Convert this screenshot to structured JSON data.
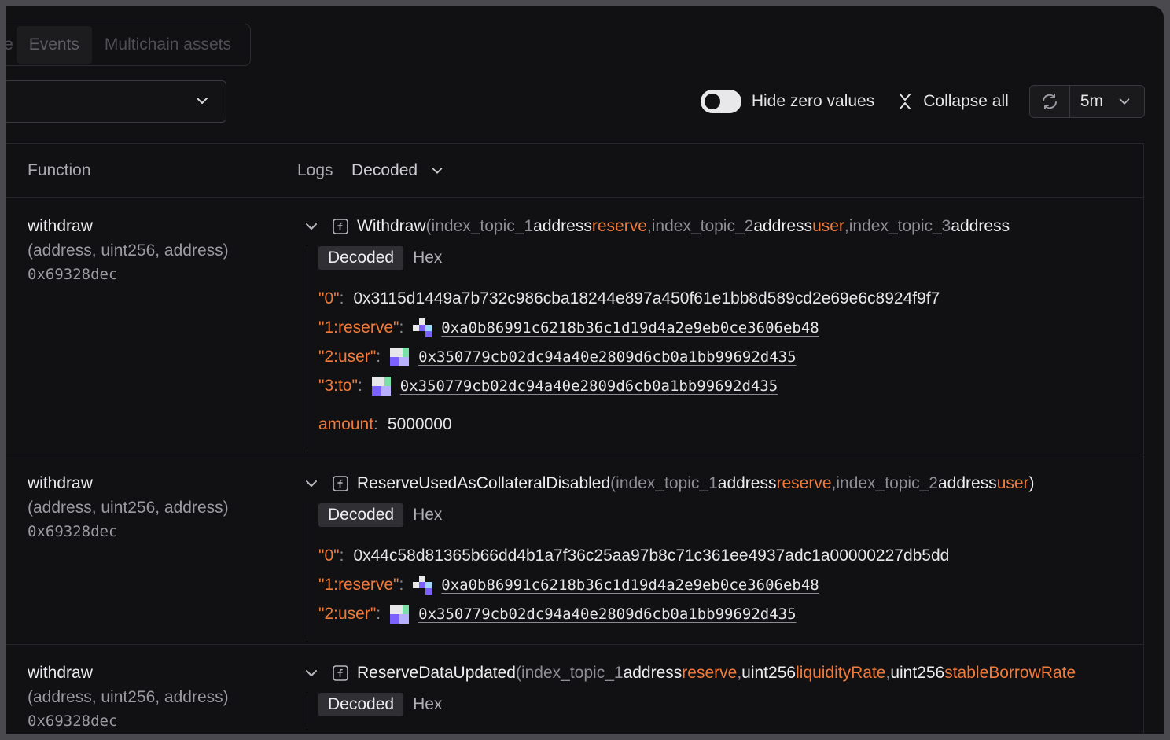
{
  "tabs": [
    "e",
    "Events",
    "Multichain assets"
  ],
  "toolbar": {
    "hide_zero_label": "Hide zero values",
    "collapse_label": "Collapse all",
    "interval": "5m"
  },
  "table": {
    "col_function": "Function",
    "col_logs": "Logs",
    "logs_mode": "Decoded"
  },
  "subtabs": {
    "decoded": "Decoded",
    "hex": "Hex"
  },
  "rows": [
    {
      "fn_name": "withdraw",
      "fn_sig": "(address, uint256, address)",
      "fn_selector": "0x69328dec",
      "event": {
        "name": "Withdraw",
        "p_open": " (",
        "t1": "index_topic_1 ",
        "t1_type": "address ",
        "t1_name": "reserve",
        "sep1": ", ",
        "t2": "index_topic_2 ",
        "t2_type": "address ",
        "t2_name": "user",
        "sep2": ", ",
        "t3": "index_topic_3 ",
        "t3_type": "address"
      },
      "fields": [
        {
          "key": "\"0\"",
          "value": "0x3115d1449a7b732c986cba18244e897a450f61e1bb8d589cd2e69e6c8924f9f7",
          "is_addr": false
        },
        {
          "key": "\"1:reserve\"",
          "value": "0xa0b86991c6218b36c1d19d4a2e9eb0ce3606eb48",
          "is_addr": true
        },
        {
          "key": "\"2:user\"",
          "value": "0x350779cb02dc94a40e2809d6cb0a1bb99692d435",
          "is_addr": true
        },
        {
          "key": "\"3:to\"",
          "value": "0x350779cb02dc94a40e2809d6cb0a1bb99692d435",
          "is_addr": true
        }
      ],
      "amount_key": "amount",
      "amount_value": "5000000"
    },
    {
      "fn_name": "withdraw",
      "fn_sig": "(address, uint256, address)",
      "fn_selector": "0x69328dec",
      "event": {
        "name": "ReserveUsedAsCollateralDisabled",
        "p_open": " (",
        "t1": "index_topic_1 ",
        "t1_type": "address ",
        "t1_name": "reserve",
        "sep1": ", ",
        "t2": "index_topic_2 ",
        "t2_type": "address ",
        "t2_name": "user",
        "p_close": ")"
      },
      "fields": [
        {
          "key": "\"0\"",
          "value": "0x44c58d81365b66dd4b1a7f36c25aa97b8c71c361ee4937adc1a00000227db5dd",
          "is_addr": false
        },
        {
          "key": "\"1:reserve\"",
          "value": "0xa0b86991c6218b36c1d19d4a2e9eb0ce3606eb48",
          "is_addr": true
        },
        {
          "key": "\"2:user\"",
          "value": "0x350779cb02dc94a40e2809d6cb0a1bb99692d435",
          "is_addr": true
        }
      ]
    },
    {
      "fn_name": "withdraw",
      "fn_sig": "(address, uint256, address)",
      "fn_selector": "0x69328dec",
      "event": {
        "name": "ReserveDataUpdated",
        "p_open": " (",
        "t1": "index_topic_1 ",
        "t1_type": "address ",
        "t1_name": "reserve",
        "sep1": ",  ",
        "a2_type": "uint256 ",
        "a2_name": "liquidityRate",
        "sep2": ",  ",
        "a3_type": "uint256 ",
        "a3_name": "stableBorrowRate"
      }
    }
  ],
  "colors": {
    "accent_orange": "#f07a3a",
    "bg": "#111113",
    "blockie_purple": "#7b61ff",
    "blockie_green": "#7be0a8"
  }
}
